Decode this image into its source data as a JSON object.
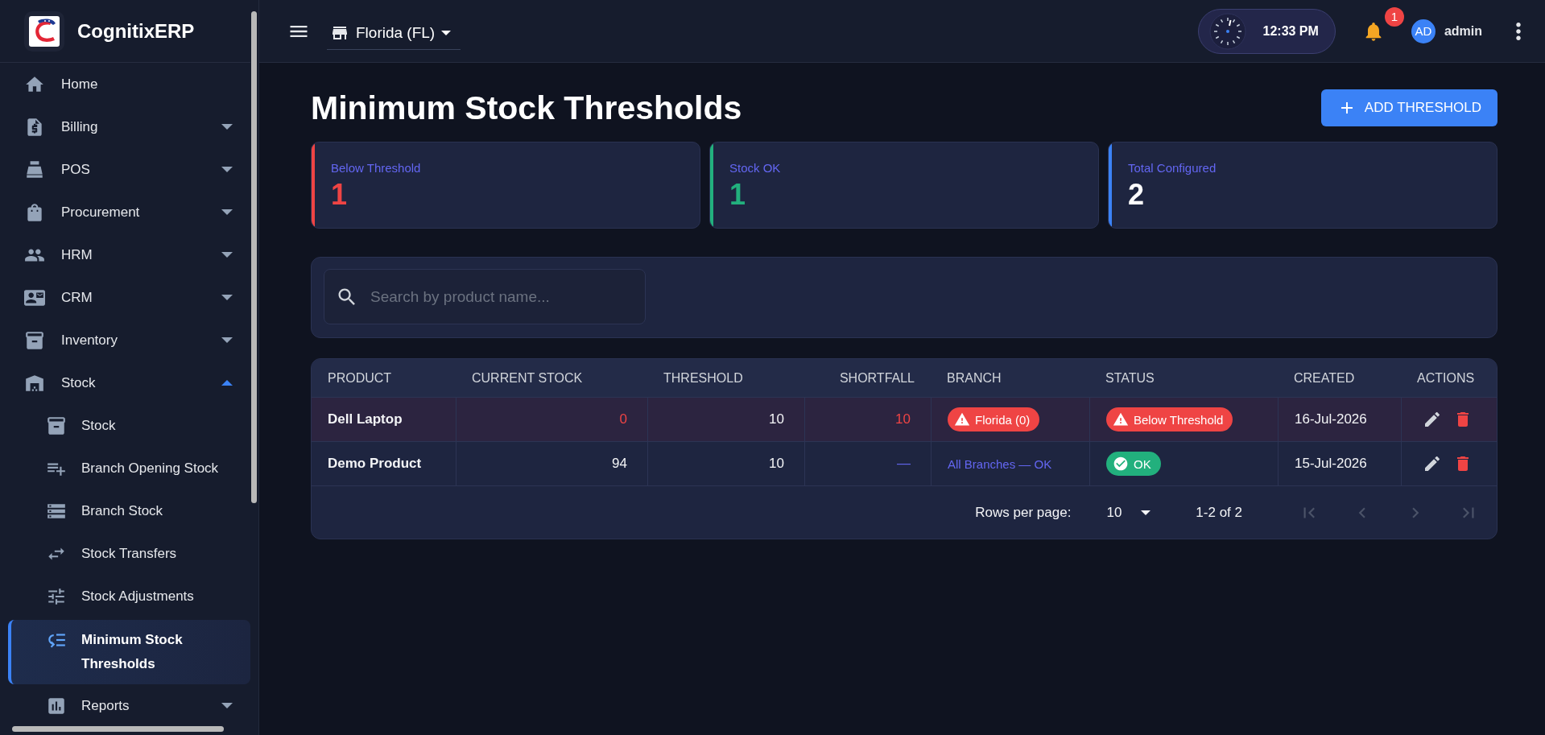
{
  "app": {
    "name": "CognitixERP"
  },
  "sidebar": {
    "items": [
      {
        "label": "Home",
        "selected": false
      },
      {
        "label": "Billing",
        "selected": false,
        "expanded": false
      },
      {
        "label": "POS",
        "selected": false,
        "expanded": false
      },
      {
        "label": "Procurement",
        "selected": false,
        "expanded": false
      },
      {
        "label": "HRM",
        "selected": false,
        "expanded": false
      },
      {
        "label": "CRM",
        "selected": false,
        "expanded": false
      },
      {
        "label": "Inventory",
        "selected": false,
        "expanded": false
      },
      {
        "label": "Stock",
        "selected": false,
        "expanded": true,
        "children": [
          {
            "label": "Stock",
            "selected": false
          },
          {
            "label": "Branch Opening Stock",
            "selected": false
          },
          {
            "label": "Branch Stock",
            "selected": false
          },
          {
            "label": "Stock Transfers",
            "selected": false
          },
          {
            "label": "Stock Adjustments",
            "selected": false
          },
          {
            "label": "Minimum Stock Thresholds",
            "selected": true
          },
          {
            "label": "Reports",
            "selected": false,
            "expanded": false
          }
        ]
      }
    ]
  },
  "header": {
    "branch": "Florida (FL)",
    "clock": "12:33 PM",
    "notification_count": "1",
    "avatar": "AD",
    "user": "admin"
  },
  "page": {
    "title": "Minimum Stock Thresholds",
    "add_button": "ADD THRESHOLD"
  },
  "stats": [
    {
      "label": "Below Threshold",
      "value": "1",
      "color": "#ef4444",
      "kind": "accent"
    },
    {
      "label": "Stock OK",
      "value": "1",
      "color": "#22b07d",
      "kind": "accent"
    },
    {
      "label": "Total Configured",
      "value": "2",
      "color": "#3b82f6",
      "kind": "plain"
    }
  ],
  "search": {
    "placeholder": "Search by product name..."
  },
  "table": {
    "columns": [
      "PRODUCT",
      "CURRENT STOCK",
      "THRESHOLD",
      "SHORTFALL",
      "BRANCH",
      "STATUS",
      "CREATED",
      "ACTIONS"
    ],
    "rows": [
      {
        "product": "Dell Laptop",
        "current_stock": "0",
        "threshold": "10",
        "shortfall": "10",
        "below_threshold": true,
        "branch": {
          "text": "Florida (0)",
          "kind": "alert"
        },
        "status": {
          "text": "Below Threshold",
          "kind": "alert"
        },
        "created": "16-Jul-2026"
      },
      {
        "product": "Demo Product",
        "current_stock": "94",
        "threshold": "10",
        "shortfall": "—",
        "below_threshold": false,
        "branch": {
          "text": "All Branches — OK",
          "kind": "text"
        },
        "status": {
          "text": "OK",
          "kind": "ok"
        },
        "created": "15-Jul-2026"
      }
    ]
  },
  "pagination": {
    "rows_per_page_label": "Rows per page:",
    "rows_per_page": "10",
    "range": "1-2 of 2",
    "buttons": [
      {
        "disabled": true
      },
      {
        "disabled": true
      },
      {
        "disabled": true
      },
      {
        "disabled": true
      }
    ]
  }
}
